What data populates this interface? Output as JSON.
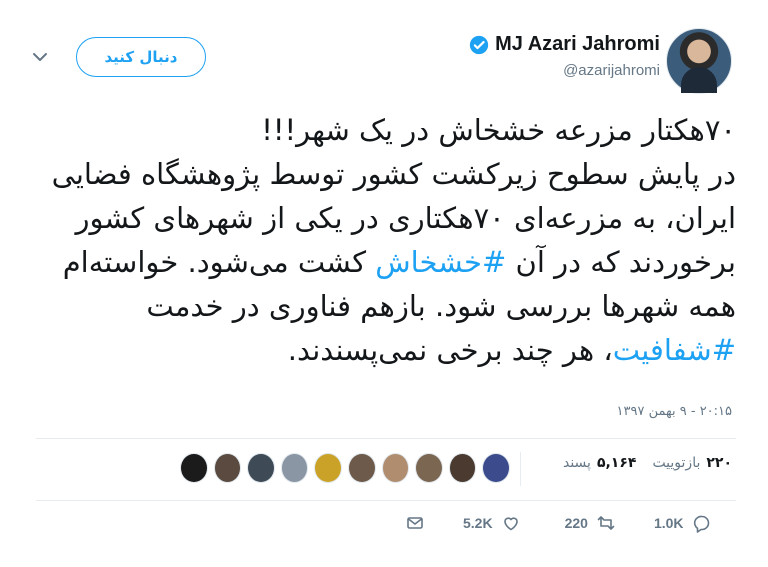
{
  "user": {
    "display_name": "MJ Azari Jahromi",
    "handle": "@azarijahromi",
    "follow_label": "دنبال کنید"
  },
  "tweet": {
    "line1": "۷۰هکتار مزرعه خشخاش در یک شهر!!!",
    "line2": "در پایش سطوح زیرکشت کشور توسط پژوهشگاه فضایی ایران، به مزرعه‌ای ۷۰هکتاری در یکی از شهرهای کشور برخوردند که در آن",
    "hashtag1": "#خشخاش",
    "line3": "کشت می‌شود. خواسته‌ام همه شهرها بررسی شود. بازهم فناوری در خدمت",
    "hashtag2": "#شفافیت",
    "line4": "، هر چند برخی نمی‌پسندند.",
    "timestamp": "۲۰:۱۵ - ۹ بهمن ۱۳۹۷"
  },
  "stats": {
    "retweets_num": "۲۲۰",
    "retweets_label": "بازتوییت",
    "likes_num": "۵,۱۶۴",
    "likes_label": "پسند"
  },
  "actions": {
    "reply_count": "1.0K",
    "retweet_count": "220",
    "like_count": "5.2K"
  },
  "faces": [
    {
      "color": "#1b1b1b"
    },
    {
      "color": "#5a4a3f"
    },
    {
      "color": "#3f4a57"
    },
    {
      "color": "#8a96a3"
    },
    {
      "color": "#c9a227"
    },
    {
      "color": "#6d5a4a"
    },
    {
      "color": "#b08d6f"
    },
    {
      "color": "#7b6652"
    },
    {
      "color": "#4b3a2f"
    },
    {
      "color": "#3c4b8c"
    }
  ]
}
